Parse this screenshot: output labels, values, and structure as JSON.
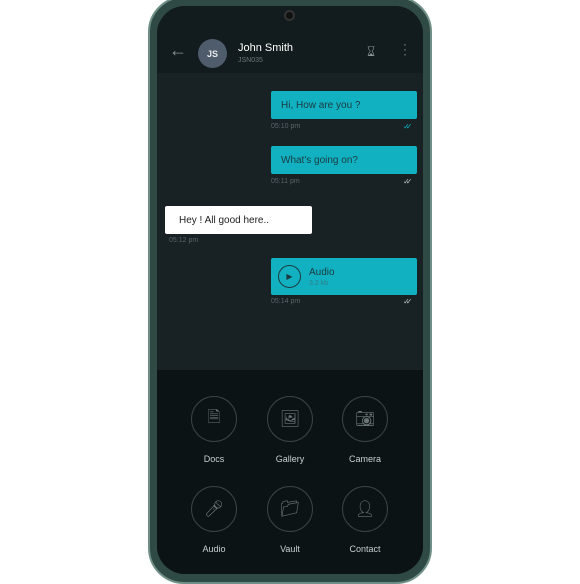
{
  "header": {
    "avatar_initials": "JS",
    "name": "John Smith",
    "subtitle": "JSN035"
  },
  "messages": [
    {
      "direction": "out",
      "text": "Hi, How are you ?",
      "time": "05:10 pm",
      "status": "read"
    },
    {
      "direction": "out",
      "text": "What's going on?",
      "time": "05:11 pm",
      "status": "delivered"
    },
    {
      "direction": "in",
      "text": "Hey ! All good here..",
      "time": "05:12 pm"
    },
    {
      "direction": "out",
      "type": "audio",
      "text": "Audio",
      "size": "3.2 kb",
      "time": "05:14 pm",
      "status": "delivered"
    }
  ],
  "attachments": [
    {
      "label": "Docs",
      "icon": "document-icon"
    },
    {
      "label": "Gallery",
      "icon": "image-icon"
    },
    {
      "label": "Camera",
      "icon": "camera-icon"
    },
    {
      "label": "Audio",
      "icon": "microphone-icon"
    },
    {
      "label": "Vault",
      "icon": "folder-icon"
    },
    {
      "label": "Contact",
      "icon": "person-icon"
    }
  ],
  "colors": {
    "outgoing_bubble": "#12b1c2",
    "incoming_bubble": "#ffffff",
    "read_tick": "#12b1c2"
  }
}
